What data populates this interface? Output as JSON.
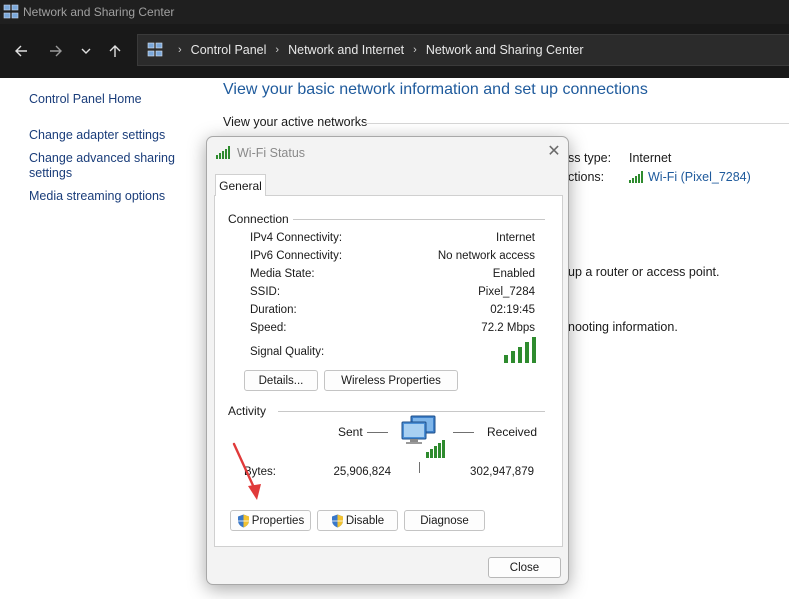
{
  "window": {
    "title": "Network and Sharing Center"
  },
  "address_bar": {
    "crumbs": [
      "Control Panel",
      "Network and Internet",
      "Network and Sharing Center"
    ],
    "separator": "›"
  },
  "left_nav": {
    "items": [
      "Control Panel Home",
      "Change adapter settings",
      "Change advanced sharing settings",
      "Media streaming options"
    ]
  },
  "main": {
    "title": "View your basic network information and set up connections",
    "active_networks_label": "View your active networks",
    "access_type_label": "ss type:",
    "access_type_value": "Internet",
    "connections_label": "ctions:",
    "connections_value": "Wi-Fi (Pixel_7284)",
    "router_text": "up a router or access point.",
    "troubleshoot_text": "nooting information."
  },
  "dialog": {
    "title": "Wi-Fi Status",
    "close_glyph": "✕",
    "tab": "General",
    "connection_group": "Connection",
    "rows": [
      {
        "label": "IPv4 Connectivity:",
        "value": "Internet"
      },
      {
        "label": "IPv6 Connectivity:",
        "value": "No network access"
      },
      {
        "label": "Media State:",
        "value": "Enabled"
      },
      {
        "label": "SSID:",
        "value": "Pixel_7284"
      },
      {
        "label": "Duration:",
        "value": "02:19:45"
      },
      {
        "label": "Speed:",
        "value": "72.2 Mbps"
      }
    ],
    "signal_quality_label": "Signal Quality:",
    "signal_bars": 5,
    "details_button": "Details...",
    "wireless_props_button": "Wireless Properties",
    "activity_group": "Activity",
    "sent_label": "Sent",
    "received_label": "Received",
    "bytes_label": "Bytes:",
    "bytes_sent": "25,906,824",
    "bytes_received": "302,947,879",
    "properties_button": "Properties",
    "disable_button": "Disable",
    "diagnose_button": "Diagnose",
    "close_button": "Close"
  },
  "colors": {
    "link": "#1e5a9c",
    "signal_green": "#2e8b2e",
    "annotation_arrow": "#e03a3a"
  }
}
